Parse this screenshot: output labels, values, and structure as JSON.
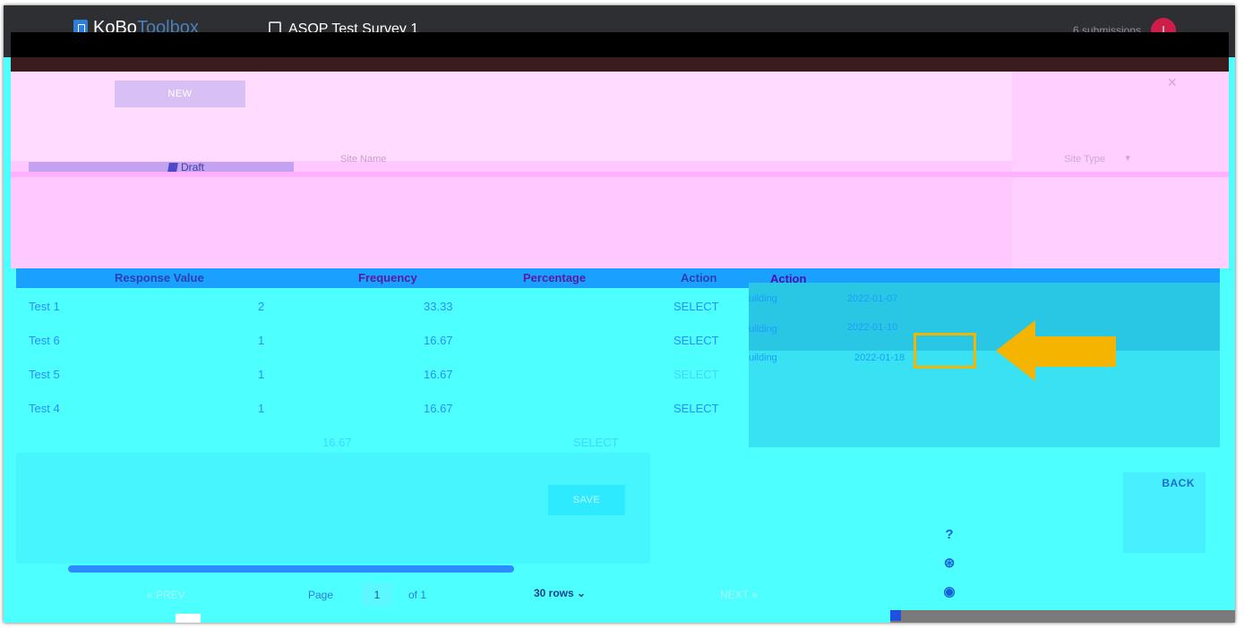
{
  "header": {
    "logo_bold": "KoBo",
    "logo_light": "Toolbox",
    "survey_title": "ASOP Test Survey 1",
    "submissions": "6 submissions",
    "avatar_initial": "I"
  },
  "overlay": {
    "new_button": "NEW",
    "site_name_label": "Site Name",
    "draft_label": "Draft",
    "site_type_label": "Site Type",
    "site_type_caret": "▾",
    "close_symbol": "×"
  },
  "table": {
    "columns": [
      "Response Value",
      "Frequency",
      "Percentage",
      "Action"
    ],
    "right_action_header": "Action",
    "rows": [
      {
        "value": "Test 1",
        "frequency": "2",
        "percentage": "33.33",
        "action": "SELECT"
      },
      {
        "value": "Test 6",
        "frequency": "1",
        "percentage": "16.67",
        "action": "SELECT"
      },
      {
        "value": "Test 5",
        "frequency": "1",
        "percentage": "16.67",
        "action": "SELECT"
      },
      {
        "value": "Test 4",
        "frequency": "1",
        "percentage": "16.67",
        "action": "SELECT"
      }
    ],
    "faded_row": {
      "percentage": "16.67",
      "action": "SELECT"
    }
  },
  "side_panel": {
    "rows": [
      {
        "type": "uilding",
        "date": "2022-01-07"
      },
      {
        "type": "uilding",
        "date": "2022-01-10"
      },
      {
        "type": "uilding",
        "date": "2022-01-18"
      }
    ]
  },
  "actions": {
    "save_label": "SAVE",
    "back_label": "BACK"
  },
  "pagination": {
    "prev_label": "« PREV",
    "page_label": "Page",
    "page_value": "1",
    "of_label": "of 1",
    "rows_label": "30 rows",
    "next_label": "NEXT »"
  },
  "icons": {
    "help": "?",
    "support": "⊛",
    "github": "◉"
  }
}
